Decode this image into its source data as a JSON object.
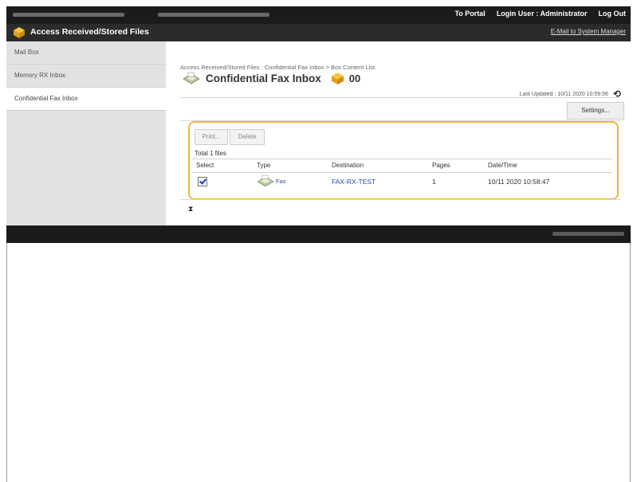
{
  "topbar": {
    "links": [
      "To Portal",
      "Login User : Administrator",
      "Log Out"
    ]
  },
  "titlebar": {
    "title": "Access Received/Stored Files",
    "mail_link": "E-Mail to System Manager"
  },
  "sidebar": {
    "items": [
      {
        "label": "Mail Box"
      },
      {
        "label": "Memory RX Inbox"
      },
      {
        "label": "Confidential Fax Inbox"
      }
    ]
  },
  "main": {
    "breadcrumb": "Access Received/Stored Files : Confidential Fax Inbox > Box Content List",
    "heading": "Confidential Fax Inbox",
    "box_number": "00",
    "last_updated": "Last Updated : 10/11 2020 10:59:56",
    "settings_label": "Settings..."
  },
  "panel": {
    "print_label": "Print...",
    "delete_label": "Delete",
    "total": "Total 1 files",
    "columns": [
      "Select",
      "Type",
      "Destination",
      "Pages",
      "Date/Time"
    ],
    "rows": [
      {
        "type": "Fax",
        "destination": "FAX-RX-TEST",
        "pages": "1",
        "datetime": "10/11 2020 10:58:47",
        "selected": true
      }
    ]
  },
  "pager": {
    "symbol": "⧗"
  },
  "colors": {
    "accent_border": "#f2b33b",
    "link": "#2a49a8",
    "header_bg": "#1b1b1b"
  }
}
